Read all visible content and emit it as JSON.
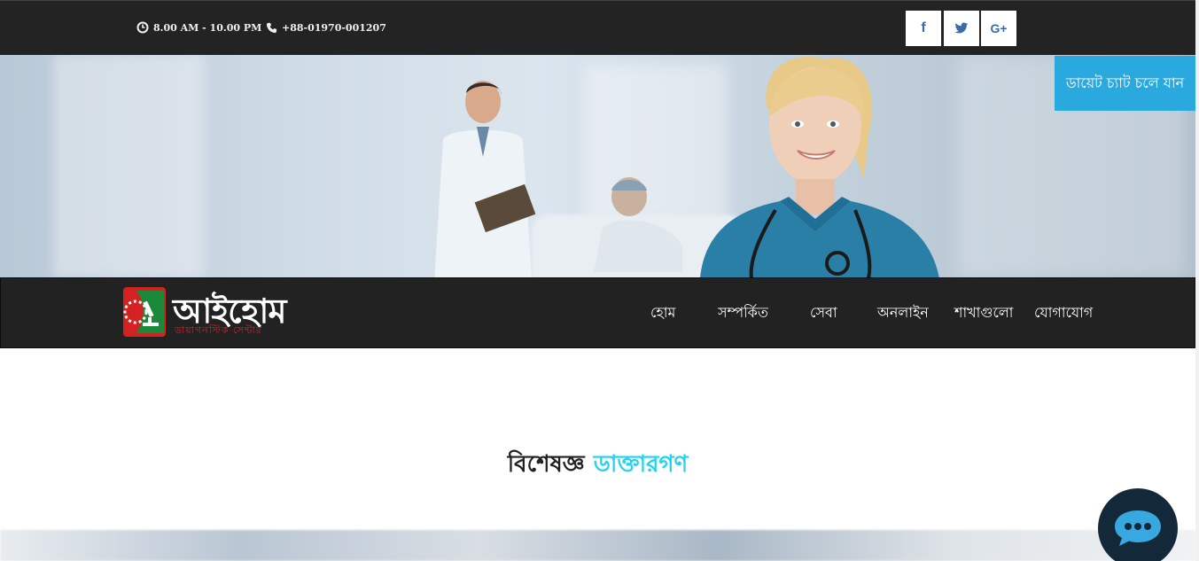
{
  "topbar": {
    "hours": "8.00 AM - 10.00 PM",
    "phone": "+88-01970-001207",
    "social": {
      "facebook": "f",
      "twitter": "t",
      "google_plus": "G+"
    }
  },
  "hero": {
    "chat_cta": "ডায়েট চ্যাট চলে যান"
  },
  "navbar": {
    "logo_text": "আইহোম",
    "logo_sub": "ডায়াগনস্টিক সেন্টার",
    "items": [
      "হোম",
      "সম্পর্কিত",
      "সেবা",
      "অনলাইন",
      "শাখাগুলো",
      "যোগাযোগ"
    ]
  },
  "section": {
    "title_part1": "বিশেষজ্ঞ",
    "title_part2": "ডাক্তারগণ"
  },
  "colors": {
    "accent_cyan": "#22d3ef",
    "cta_blue": "#2aa9df",
    "dark_bar": "#222222",
    "logo_red": "#e02020",
    "logo_green": "#1a8a3a"
  },
  "icons": [
    "clock-icon",
    "phone-icon",
    "facebook-icon",
    "twitter-icon",
    "google-plus-icon",
    "chat-icon"
  ]
}
